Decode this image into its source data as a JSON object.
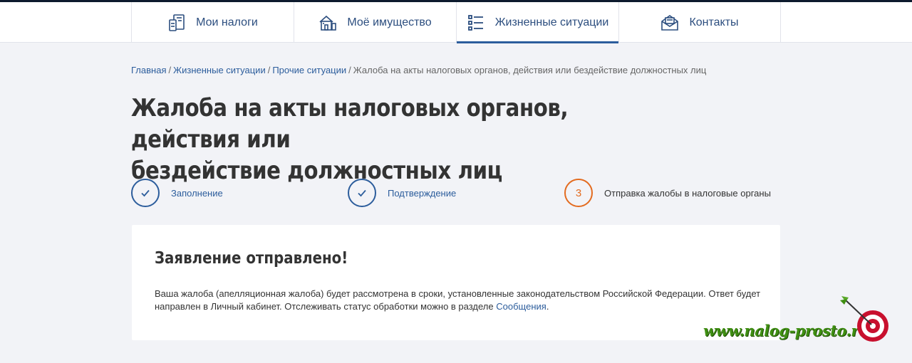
{
  "nav": {
    "items": [
      {
        "label": "Мои налоги",
        "icon": "tax-documents-icon",
        "active": false
      },
      {
        "label": "Моё имущество",
        "icon": "property-house-icon",
        "active": false
      },
      {
        "label": "Жизненные ситуации",
        "icon": "list-icon",
        "active": true
      },
      {
        "label": "Контакты",
        "icon": "envelope-icon",
        "active": false
      }
    ]
  },
  "breadcrumb": {
    "home": "Главная",
    "life": "Жизненные ситуации",
    "other": "Прочие ситуации",
    "current": "Жалоба на акты налоговых органов, действия или бездействие должностных лиц"
  },
  "page": {
    "title_line1": "Жалоба на акты налоговых органов, действия или",
    "title_line2": "бездействие должностных лиц"
  },
  "steps": [
    {
      "label": "Заполнение",
      "state": "done"
    },
    {
      "label": "Подтверждение",
      "state": "done"
    },
    {
      "number": "3",
      "label": "Отправка жалобы в налоговые органы",
      "state": "current"
    }
  ],
  "card": {
    "heading": "Заявление отправлено!",
    "text_before": "Ваша жалоба (апелляционная жалоба) будет рассмотрена в сроки, установленные законодательством Российской  Федерации. Ответ будет направлен в Личный кабинет. Отслеживать статус обработки можно в разделе ",
    "link": "Сообщения",
    "text_after": "."
  },
  "watermark": {
    "text": "www.nalog-prosto.ru"
  },
  "colors": {
    "primary": "#2c5d9c",
    "accent": "#e36b1f",
    "background": "#f2f3f7"
  }
}
